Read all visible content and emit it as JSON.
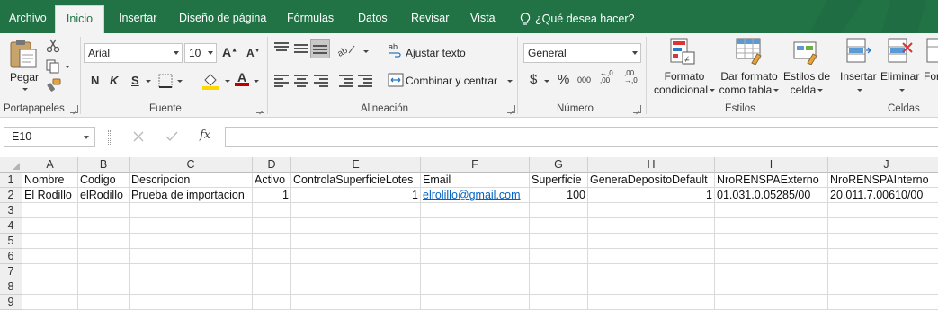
{
  "tabs": [
    {
      "label": "Archivo",
      "active": false
    },
    {
      "label": "Inicio",
      "active": true
    },
    {
      "label": "Insertar",
      "active": false
    },
    {
      "label": "Diseño de página",
      "active": false
    },
    {
      "label": "Fórmulas",
      "active": false
    },
    {
      "label": "Datos",
      "active": false
    },
    {
      "label": "Revisar",
      "active": false
    },
    {
      "label": "Vista",
      "active": false
    }
  ],
  "tell_me": "¿Qué desea hacer?",
  "ribbon": {
    "clipboard": {
      "paste": "Pegar",
      "group": "Portapapeles"
    },
    "font": {
      "name": "Arial",
      "size": "10",
      "bold": "N",
      "italic": "K",
      "underline": "S",
      "group": "Fuente"
    },
    "alignment": {
      "wrap": "Ajustar texto",
      "merge": "Combinar y centrar",
      "group": "Alineación"
    },
    "number": {
      "format": "General",
      "currency": "$",
      "percent": "%",
      "thousands": "000",
      "inc_decimals": "←,0 ,00",
      "dec_decimals": ",00 →,0",
      "group": "Número"
    },
    "styles": {
      "conditional": [
        "Formato",
        "condicional"
      ],
      "table": [
        "Dar formato",
        "como tabla"
      ],
      "cell": [
        "Estilos de",
        "celda"
      ],
      "group": "Estilos"
    },
    "cells": {
      "insert": "Insertar",
      "delete": "Eliminar",
      "format": "For",
      "group": "Celdas"
    }
  },
  "formula_bar": {
    "name_box": "E10",
    "fx": "fx",
    "value": ""
  },
  "columns": [
    "A",
    "B",
    "C",
    "D",
    "E",
    "F",
    "G",
    "H",
    "I",
    "J"
  ],
  "rows": [
    "1",
    "2",
    "3",
    "4",
    "5",
    "6",
    "7",
    "8",
    "9"
  ],
  "cells": [
    [
      "Nombre",
      "Codigo",
      "Descripcion",
      "Activo",
      "ControlaSuperficieLotes",
      "Email",
      "Superficie",
      "GeneraDepositoDefault",
      "NroRENSPAExterno",
      "NroRENSPAInterno"
    ],
    [
      "El Rodillo",
      "elRodillo",
      "Prueba de importacion",
      "1",
      "1",
      "elrolillo@gmail.com",
      "100",
      "1",
      "01.031.0.05285/00",
      "20.011.7.00610/00"
    ]
  ],
  "colors": {
    "brand": "#217346",
    "link": "#0563c1",
    "fill_yellow": "#ffd700",
    "font_red": "#c00000"
  }
}
